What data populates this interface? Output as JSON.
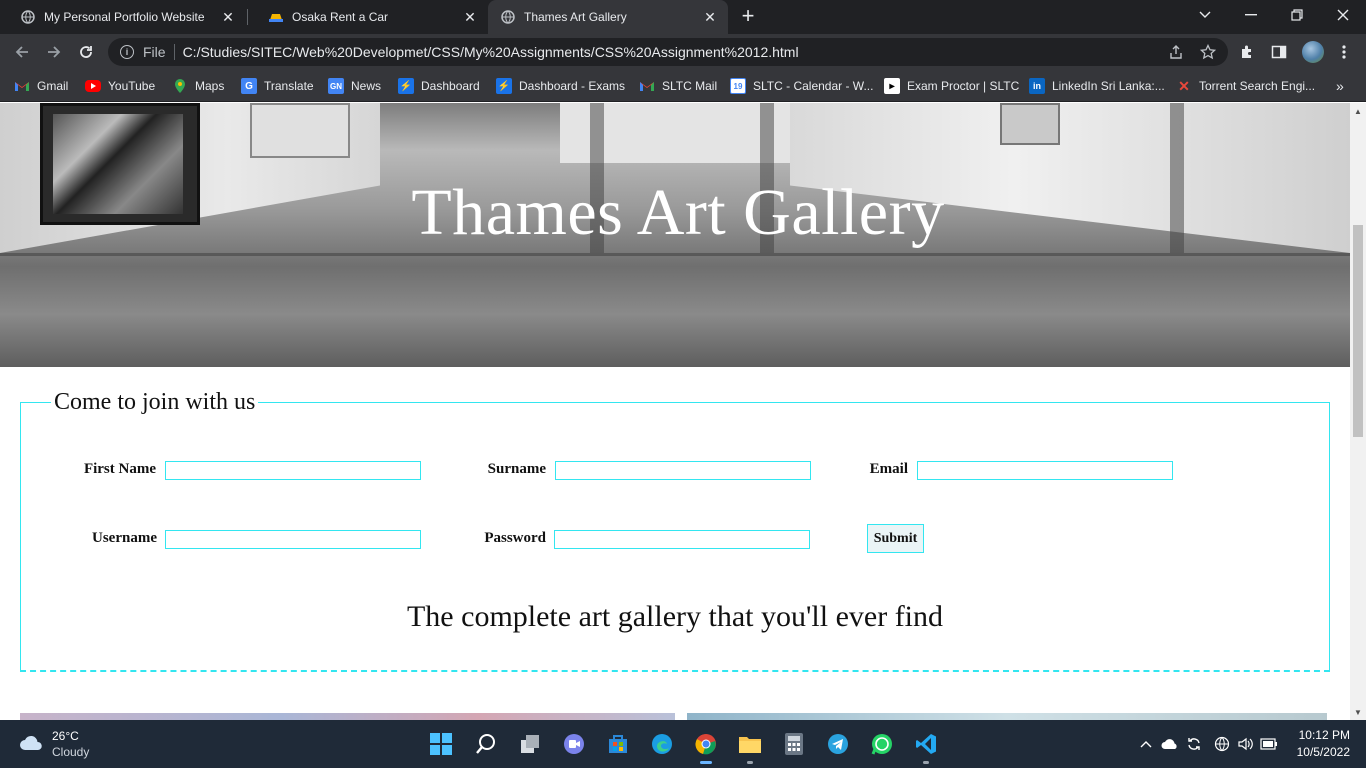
{
  "browser": {
    "tabs": [
      {
        "title": "My Personal Portfolio Website",
        "active": false
      },
      {
        "title": "Osaka Rent a Car",
        "active": false
      },
      {
        "title": "Thames Art Gallery",
        "active": true
      }
    ],
    "address": {
      "scheme": "File",
      "url": "C:/Studies/SITEC/Web%20Developmet/CSS/My%20Assignments/CSS%20Assignment%2012.html"
    },
    "bookmarks": [
      {
        "label": "Gmail",
        "icon": "gmail-icon",
        "color": "#ea4335"
      },
      {
        "label": "YouTube",
        "icon": "youtube-icon",
        "color": "#ff0000"
      },
      {
        "label": "Maps",
        "icon": "maps-icon",
        "color": "#34a853"
      },
      {
        "label": "Translate",
        "icon": "translate-icon",
        "color": "#4285f4"
      },
      {
        "label": "News",
        "icon": "news-icon",
        "color": "#4285f4"
      },
      {
        "label": "Dashboard",
        "icon": "dashboard-icon",
        "color": "#1a73e8"
      },
      {
        "label": "Dashboard - Exams",
        "icon": "dashboard-exams-icon",
        "color": "#1a73e8"
      },
      {
        "label": "SLTC Mail",
        "icon": "gmail-icon",
        "color": "#ea4335"
      },
      {
        "label": "SLTC - Calendar - W...",
        "icon": "calendar-icon",
        "color": "#4285f4"
      },
      {
        "label": "Exam Proctor | SLTC",
        "icon": "exam-proctor-icon",
        "color": "#ffffff"
      },
      {
        "label": "LinkedIn Sri Lanka:...",
        "icon": "linkedin-icon",
        "color": "#0a66c2"
      },
      {
        "label": "Torrent Search Engi...",
        "icon": "torrent-icon",
        "color": "#e8483b"
      }
    ]
  },
  "page": {
    "hero_title": "Thames Art Gallery",
    "form": {
      "legend": "Come to join with us",
      "first_name_label": "First Name",
      "surname_label": "Surname",
      "email_label": "Email",
      "username_label": "Username",
      "password_label": "Password",
      "first_name_value": "",
      "surname_value": "",
      "email_value": "",
      "username_value": "",
      "password_value": "",
      "submit_label": "Submit"
    },
    "tagline": "The complete art gallery that you'll ever find",
    "accent_color": "#33e6f0"
  },
  "taskbar": {
    "weather_temp": "26°C",
    "weather_desc": "Cloudy",
    "time": "10:12 PM",
    "date": "10/5/2022"
  }
}
